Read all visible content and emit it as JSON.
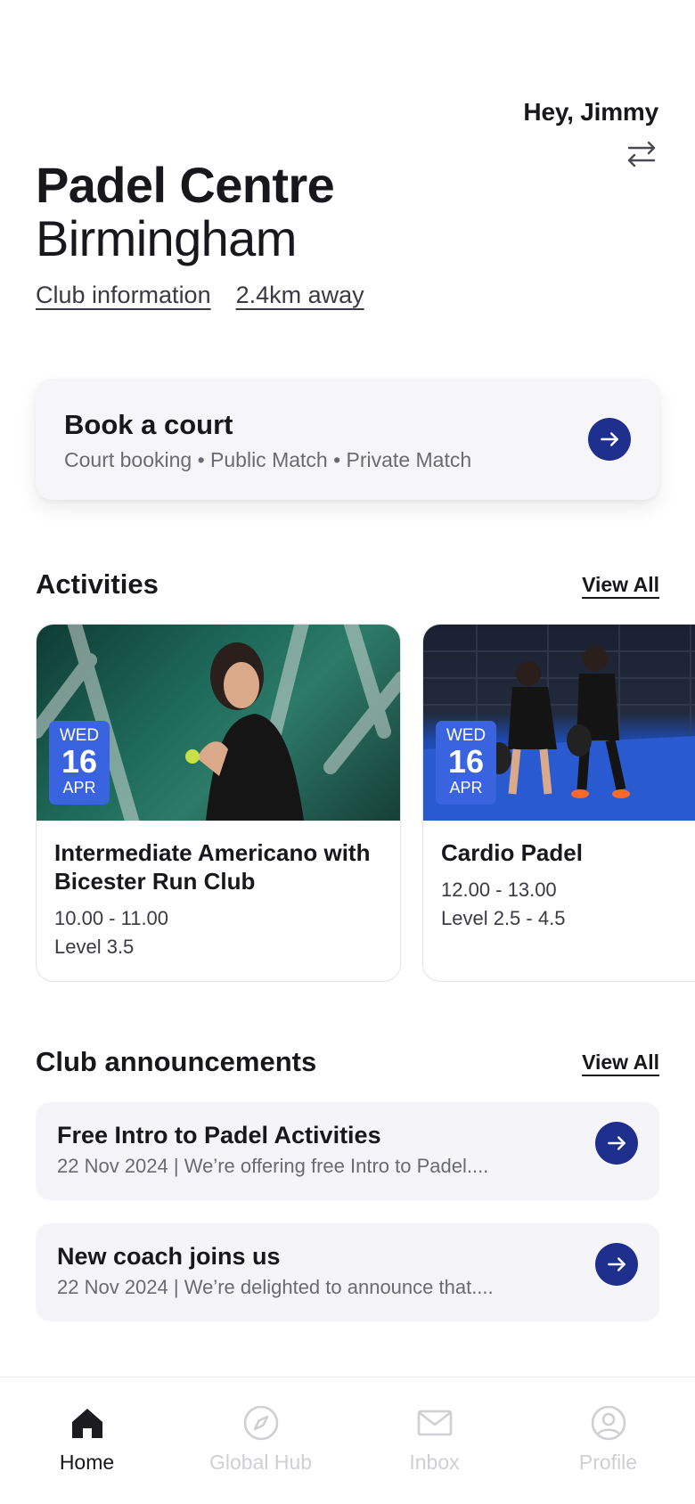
{
  "header": {
    "greeting": "Hey, Jimmy",
    "switch_icon": "swap-arrows-icon",
    "club_name_line1": "Padel Centre",
    "club_name_line2": "Birmingham",
    "club_info_link": "Club information",
    "distance_link": "2.4km away"
  },
  "book_court": {
    "title": "Book a court",
    "subtitle": "Court booking • Public Match • Private Match",
    "icon": "arrow-right-icon"
  },
  "activities": {
    "title": "Activities",
    "view_all": "View All",
    "items": [
      {
        "dow": "WED",
        "day": "16",
        "month": "APR",
        "title": "Intermediate Americano with Bicester Run Club",
        "time": "10.00 - 11.00",
        "level": "Level 3.5"
      },
      {
        "dow": "WED",
        "day": "16",
        "month": "APR",
        "title": "Cardio Padel",
        "time": "12.00 - 13.00",
        "level": "Level 2.5 - 4.5"
      }
    ]
  },
  "announcements": {
    "title": "Club announcements",
    "view_all": "View All",
    "items": [
      {
        "title": "Free Intro to Padel Activities",
        "subtitle": "22 Nov 2024 | We’re offering free Intro to Padel...."
      },
      {
        "title": "New coach joins us",
        "subtitle": "22 Nov 2024 | We’re delighted to announce that...."
      }
    ]
  },
  "tabbar": {
    "items": [
      {
        "label": "Home",
        "icon": "home-icon",
        "active": true
      },
      {
        "label": "Global Hub",
        "icon": "compass-icon",
        "active": false
      },
      {
        "label": "Inbox",
        "icon": "mail-icon",
        "active": false
      },
      {
        "label": "Profile",
        "icon": "user-icon",
        "active": false
      }
    ]
  },
  "colors": {
    "accent": "#1e2f8e",
    "badge": "#3a63e0",
    "text": "#17171c",
    "muted": "#6a6a72",
    "inactive_tab": "#cfcfd4"
  }
}
